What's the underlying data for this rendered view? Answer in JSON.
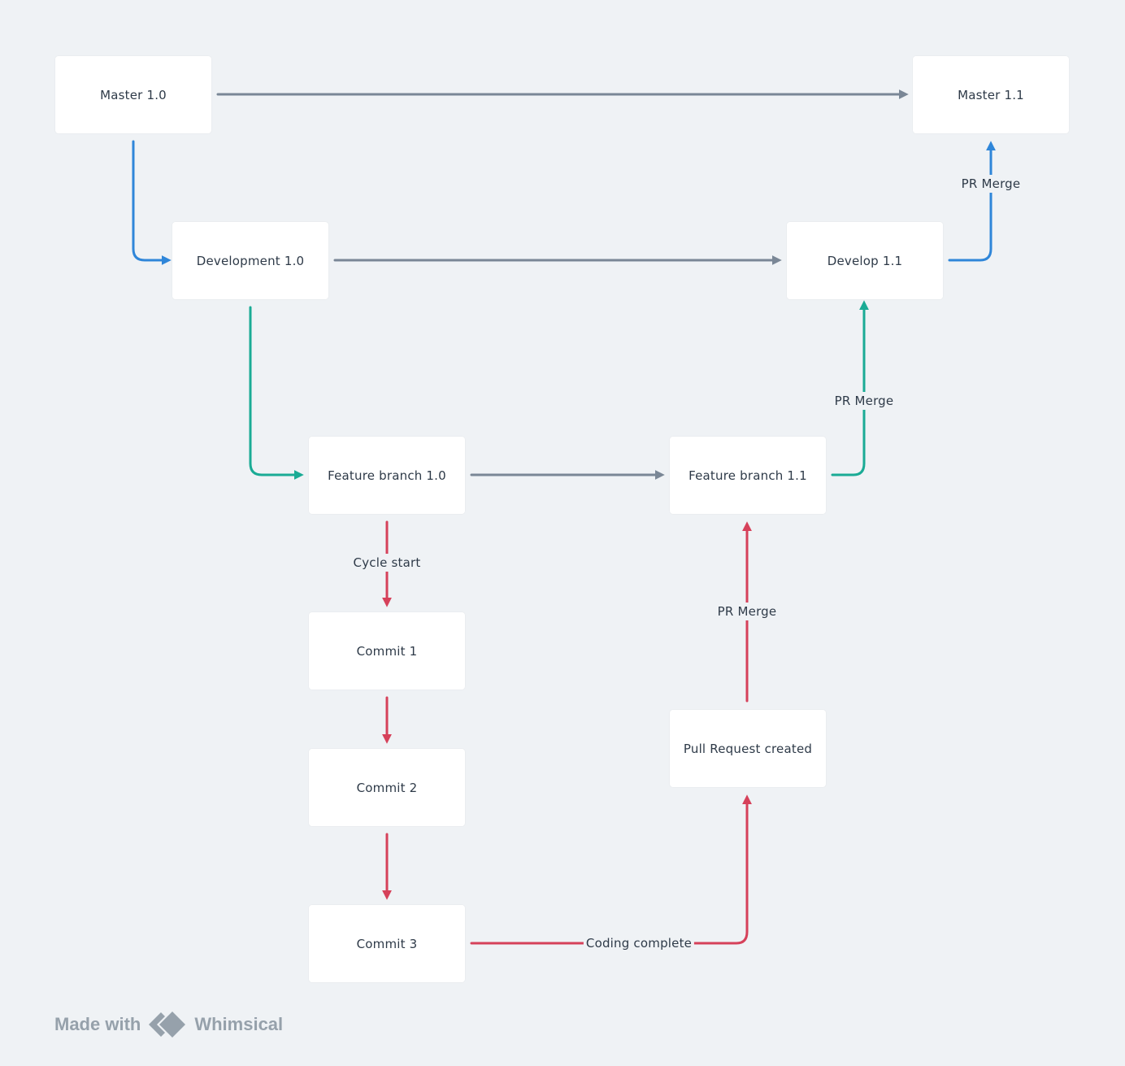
{
  "nodes": [
    {
      "id": "master10",
      "label": "Master 1.0"
    },
    {
      "id": "master11",
      "label": "Master 1.1"
    },
    {
      "id": "dev10",
      "label": "Development 1.0"
    },
    {
      "id": "dev11",
      "label": "Develop 1.1"
    },
    {
      "id": "feat10",
      "label": "Feature branch 1.0"
    },
    {
      "id": "feat11",
      "label": "Feature branch 1.1"
    },
    {
      "id": "commit1",
      "label": "Commit 1"
    },
    {
      "id": "commit2",
      "label": "Commit 2"
    },
    {
      "id": "commit3",
      "label": "Commit 3"
    },
    {
      "id": "pr",
      "label": "Pull Request created"
    }
  ],
  "edges": [
    {
      "from": "master10",
      "to": "master11",
      "color": "gray",
      "label": ""
    },
    {
      "from": "master10",
      "to": "dev10",
      "color": "blue",
      "label": ""
    },
    {
      "from": "dev10",
      "to": "dev11",
      "color": "gray",
      "label": ""
    },
    {
      "from": "dev11",
      "to": "master11",
      "color": "blue",
      "label": "PR Merge"
    },
    {
      "from": "dev10",
      "to": "feat10",
      "color": "teal",
      "label": ""
    },
    {
      "from": "feat10",
      "to": "feat11",
      "color": "gray",
      "label": ""
    },
    {
      "from": "feat11",
      "to": "dev11",
      "color": "teal",
      "label": "PR Merge"
    },
    {
      "from": "feat10",
      "to": "commit1",
      "color": "red",
      "label": "Cycle start"
    },
    {
      "from": "commit1",
      "to": "commit2",
      "color": "red",
      "label": ""
    },
    {
      "from": "commit2",
      "to": "commit3",
      "color": "red",
      "label": ""
    },
    {
      "from": "commit3",
      "to": "pr",
      "color": "red",
      "label": "Coding complete"
    },
    {
      "from": "pr",
      "to": "feat11",
      "color": "red",
      "label": "PR Merge"
    }
  ],
  "colors": {
    "gray": "#7a8796",
    "blue": "#2f86d9",
    "teal": "#1aab95",
    "red": "#d6415a",
    "background": "#eff2f5"
  },
  "watermark": {
    "prefix": "Made with",
    "brand": "Whimsical",
    "icon": "whimsical-logo-icon"
  }
}
